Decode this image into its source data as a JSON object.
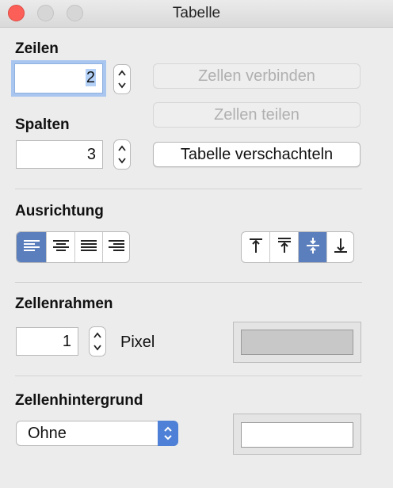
{
  "window": {
    "title": "Tabelle"
  },
  "rows": {
    "label": "Zeilen",
    "value": "2"
  },
  "columns": {
    "label": "Spalten",
    "value": "3"
  },
  "buttons": {
    "merge": "Zellen verbinden",
    "split": "Zellen teilen",
    "nest": "Tabelle verschachteln"
  },
  "alignment": {
    "label": "Ausrichtung",
    "horizontal": [
      "align-left",
      "align-center",
      "align-justify",
      "align-right"
    ],
    "horizontal_selected": "align-left",
    "vertical": [
      "align-top",
      "align-baseline",
      "align-middle",
      "align-bottom"
    ],
    "vertical_selected": "align-middle"
  },
  "border": {
    "label": "Zellenrahmen",
    "value": "1",
    "unit": "Pixel",
    "color": "#c8c8c8"
  },
  "background": {
    "label": "Zellenhintergrund",
    "value": "Ohne",
    "color": "#ffffff"
  },
  "colors": {
    "accent": "#5b7fbd",
    "popup_accent": "#4d80d6",
    "close": "#fc5f57"
  }
}
